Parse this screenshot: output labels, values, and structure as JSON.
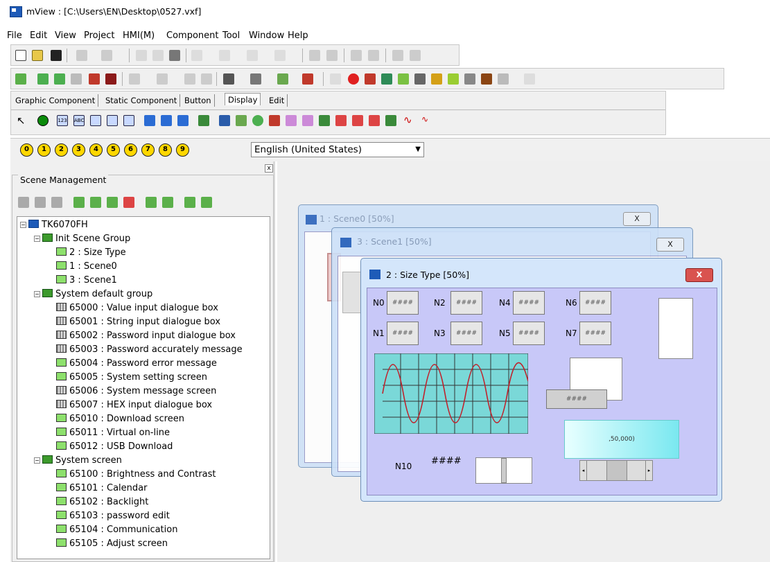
{
  "window": {
    "title": "mView : [C:\\Users\\EN\\Desktop\\0527.vxf]"
  },
  "menu": [
    "File",
    "Edit",
    "View",
    "Project",
    "HMI(M)",
    "Component",
    "Tool",
    "Window",
    "Help"
  ],
  "component_tabs": [
    {
      "label": "Graphic Component"
    },
    {
      "label": "Static Component"
    },
    {
      "label": "Button"
    },
    {
      "label": "Display"
    },
    {
      "label": "Edit"
    }
  ],
  "number_buttons": [
    "0",
    "1",
    "2",
    "3",
    "4",
    "5",
    "6",
    "7",
    "8",
    "9"
  ],
  "language": {
    "selected": "English (United States)"
  },
  "scene_panel": {
    "title": "Scene Management",
    "close": "x"
  },
  "tree": [
    {
      "label": "TK6070FH"
    },
    {
      "label": "Init Scene Group"
    },
    {
      "label": "2 : Size Type"
    },
    {
      "label": "1 : Scene0"
    },
    {
      "label": "3 : Scene1"
    },
    {
      "label": "System default group"
    },
    {
      "label": "65000 : Value input dialogue box"
    },
    {
      "label": "65001 : String input dialogue box"
    },
    {
      "label": "65002 : Password input dialogue box"
    },
    {
      "label": "65003 : Password accurately message"
    },
    {
      "label": "65004 : Password error message"
    },
    {
      "label": "65005 : System setting screen"
    },
    {
      "label": "65006 : System message screen"
    },
    {
      "label": "65007 : HEX input dialogue box"
    },
    {
      "label": "65010 : Download screen"
    },
    {
      "label": "65011 : Virtual on-line"
    },
    {
      "label": "65012 : USB Download"
    },
    {
      "label": "System screen"
    },
    {
      "label": "65100 : Brightness and Contrast"
    },
    {
      "label": "65101 : Calendar"
    },
    {
      "label": "65102 : Backlight"
    },
    {
      "label": "65103 : password edit"
    },
    {
      "label": "65104 : Communication"
    },
    {
      "label": "65105 : Adjust screen"
    }
  ],
  "windows": {
    "scene0": {
      "title": "1 : Scene0 [50%]",
      "close": "X"
    },
    "scene1": {
      "title": "3 : Scene1 [50%]",
      "close": "X"
    },
    "size_type": {
      "title": "2 : Size Type [50%]",
      "close": "X"
    }
  },
  "size_type": {
    "labels": [
      "N0",
      "N2",
      "N4",
      "N6",
      "N1",
      "N3",
      "N5",
      "N7"
    ],
    "placeholder": "####",
    "n10": "N10",
    "n10_value": "####",
    "ascii_text": ",50,000)"
  }
}
